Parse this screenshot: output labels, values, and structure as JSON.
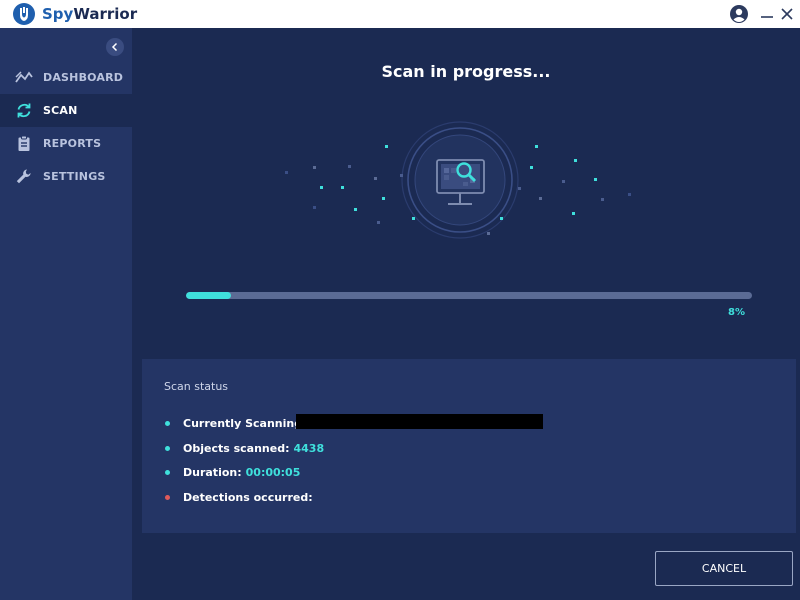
{
  "app": {
    "brand_prefix": "Spy",
    "brand_suffix": "Warrior"
  },
  "sidebar": {
    "items": [
      {
        "label": "DASHBOARD",
        "icon": "chart-line-icon",
        "active": false
      },
      {
        "label": "SCAN",
        "icon": "refresh-icon",
        "active": true
      },
      {
        "label": "REPORTS",
        "icon": "clipboard-icon",
        "active": false
      },
      {
        "label": "SETTINGS",
        "icon": "wrench-icon",
        "active": false
      }
    ]
  },
  "scan": {
    "title": "Scan in progress...",
    "progress": 8,
    "progress_label": "8%"
  },
  "status": {
    "title": "Scan status",
    "currently_scanning_label": "Currently Scanning:",
    "objects_scanned_label": "Objects scanned:",
    "objects_scanned_value": "4438",
    "duration_label": "Duration:",
    "duration_value": "00:00:05",
    "detections_label": "Detections occurred:"
  },
  "actions": {
    "cancel_label": "CANCEL"
  },
  "colors": {
    "accent": "#3fe0dc",
    "background": "#1b2a52",
    "panel": "#243565",
    "alert": "#e05a5a"
  }
}
